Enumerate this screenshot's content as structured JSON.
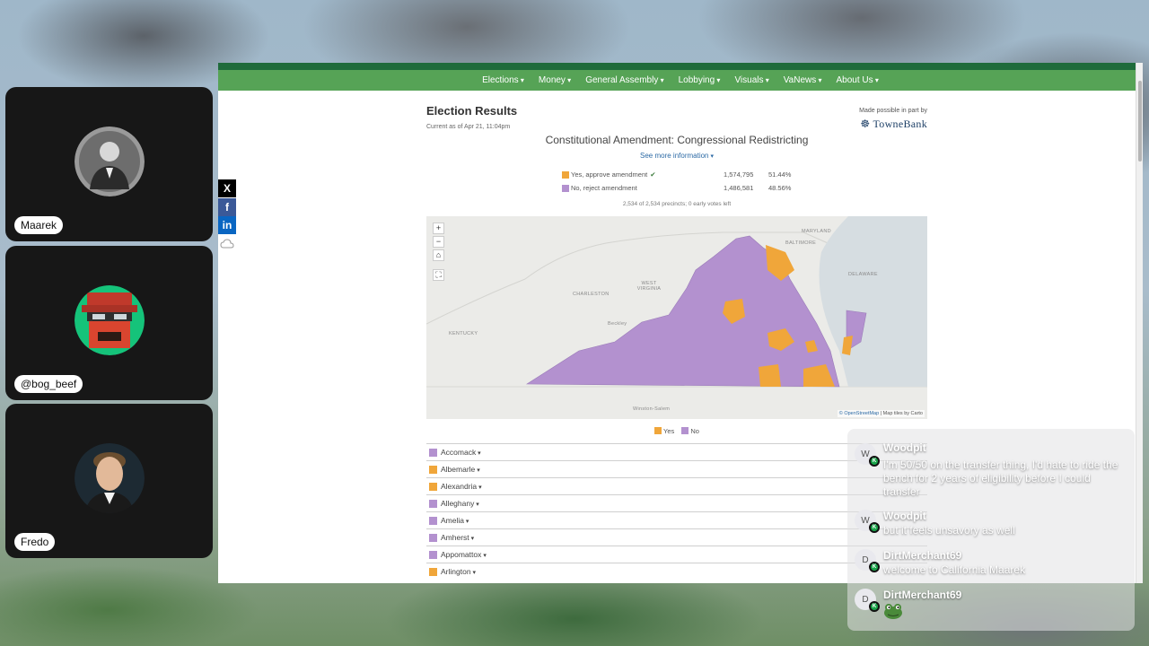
{
  "participants": [
    {
      "name": "Maarek"
    },
    {
      "name": "@bog_beef"
    },
    {
      "name": "Fredo"
    }
  ],
  "share_icons": [
    "x-icon",
    "facebook-icon",
    "linkedin-icon",
    "cloud-icon"
  ],
  "share_labels": {
    "x": "X",
    "facebook": "f",
    "linkedin": "in"
  },
  "nav": [
    "Elections",
    "Money",
    "General Assembly",
    "Lobbying",
    "Visuals",
    "VaNews",
    "About Us"
  ],
  "page": {
    "title": "Election Results",
    "as_of": "Current as of Apr 21, 11:04pm",
    "sponsor_text": "Made possible in part by",
    "sponsor_logo": "☸ TowneBank",
    "race_title": "Constitutional Amendment: Congressional Redistricting",
    "see_more": "See more information",
    "results": [
      {
        "label": "Yes, approve amendment",
        "votes": "1,574,795",
        "pct": "51.44%",
        "color": "#f0a63a",
        "winner": true
      },
      {
        "label": "No, reject amendment",
        "votes": "1,486,581",
        "pct": "48.56%",
        "color": "#b391cf",
        "winner": false
      }
    ],
    "winner_mark": "✔",
    "precincts": "2,534 of 2,534 precincts; 0 early votes left",
    "map": {
      "zoom_in": "+",
      "zoom_out": "−",
      "home": "⌂",
      "fullscreen": "⛶",
      "attribution_osm": "© OpenStreetMap",
      "attribution_rest": " | Map tiles by Carto",
      "places": {
        "maryland": "MARYLAND",
        "baltimore": "BALTIMORE",
        "west_virginia": "WEST VIRGINIA",
        "charleston": "CHARLESTON",
        "kentucky": "KENTUCKY",
        "delaware": "DELAWARE",
        "beckley": "Beckley",
        "winston_salem": "Winston-Salem"
      }
    },
    "legend": [
      {
        "label": "Yes",
        "color": "#f0a63a"
      },
      {
        "label": "No",
        "color": "#b391cf"
      }
    ],
    "localities": [
      {
        "name": "Accomack",
        "color": "#b391cf"
      },
      {
        "name": "Albemarle",
        "color": "#f0a63a"
      },
      {
        "name": "Alexandria",
        "color": "#f0a63a"
      },
      {
        "name": "Alleghany",
        "color": "#b391cf"
      },
      {
        "name": "Amelia",
        "color": "#b391cf"
      },
      {
        "name": "Amherst",
        "color": "#b391cf"
      },
      {
        "name": "Appomattox",
        "color": "#b391cf"
      },
      {
        "name": "Arlington",
        "color": "#f0a63a"
      }
    ]
  },
  "chat": [
    {
      "user": "Woodpit",
      "initial": "W",
      "text": "I'm 50/50 on the transfer thing, I'd hate to ride the bench for 2 years of eligibility before I could transfer"
    },
    {
      "user": "Woodpit",
      "initial": "W",
      "text": "but it feels unsavory as well"
    },
    {
      "user": "DirtMerchant69",
      "initial": "D",
      "text": "welcome to California Maarek"
    },
    {
      "user": "DirtMerchant69",
      "initial": "D",
      "emote": "frog-emote"
    }
  ],
  "chat_badge": "K"
}
